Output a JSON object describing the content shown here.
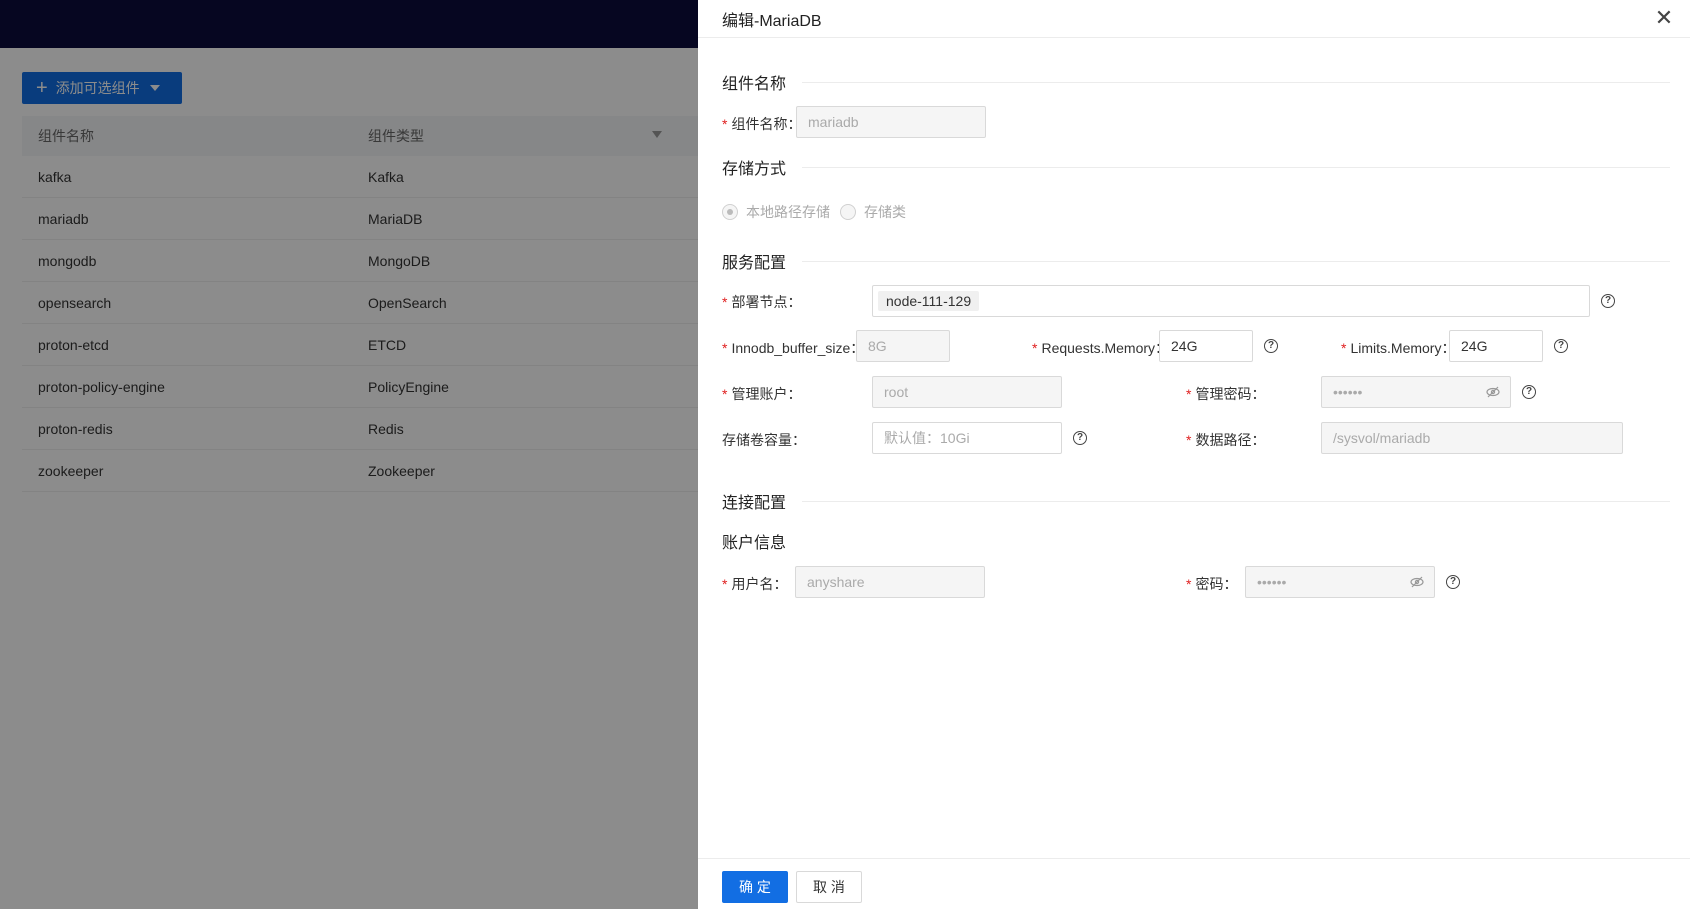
{
  "background": {
    "add_button_label": "添加可选组件",
    "table": {
      "columns": [
        "组件名称",
        "组件类型"
      ],
      "rows": [
        [
          "kafka",
          "Kafka"
        ],
        [
          "mariadb",
          "MariaDB"
        ],
        [
          "mongodb",
          "MongoDB"
        ],
        [
          "opensearch",
          "OpenSearch"
        ],
        [
          "proton-etcd",
          "ETCD"
        ],
        [
          "proton-policy-engine",
          "PolicyEngine"
        ],
        [
          "proton-redis",
          "Redis"
        ],
        [
          "zookeeper",
          "Zookeeper"
        ]
      ]
    }
  },
  "drawer": {
    "title": "编辑-MariaDB",
    "sections": {
      "component_name": "组件名称",
      "storage": "存储方式",
      "service": "服务配置",
      "connection": "连接配置",
      "account": "账户信息"
    },
    "fields": {
      "component_name": {
        "label": "组件名称：",
        "value": "mariadb"
      },
      "storage_options": [
        "本地路径存储",
        "存储类"
      ],
      "deploy_node": {
        "label": "部署节点：",
        "value": "node-111-129"
      },
      "innodb": {
        "label": "Innodb_buffer_size：",
        "value": "8G"
      },
      "requests_memory": {
        "label": "Requests.Memory：",
        "value": "24G"
      },
      "limits_memory": {
        "label": "Limits.Memory：",
        "value": "24G"
      },
      "admin_account": {
        "label": "管理账户：",
        "value": "root"
      },
      "admin_password": {
        "label": "管理密码：",
        "value": "••••••"
      },
      "volume_capacity": {
        "label": "存储卷容量：",
        "placeholder": "默认值：10Gi"
      },
      "data_path": {
        "label": "数据路径：",
        "value": "/sysvol/mariadb"
      },
      "username": {
        "label": "用户名：",
        "value": "anyshare"
      },
      "password": {
        "label": "密码：",
        "value": "••••••"
      }
    },
    "footer": {
      "ok": "确 定",
      "cancel": "取 消"
    },
    "required_mark": "*",
    "help_glyph": "?",
    "close_glyph": "✕"
  },
  "colors": {
    "primary": "#126ee3",
    "topbar": "#0c0b3d",
    "required": "#e02020"
  }
}
